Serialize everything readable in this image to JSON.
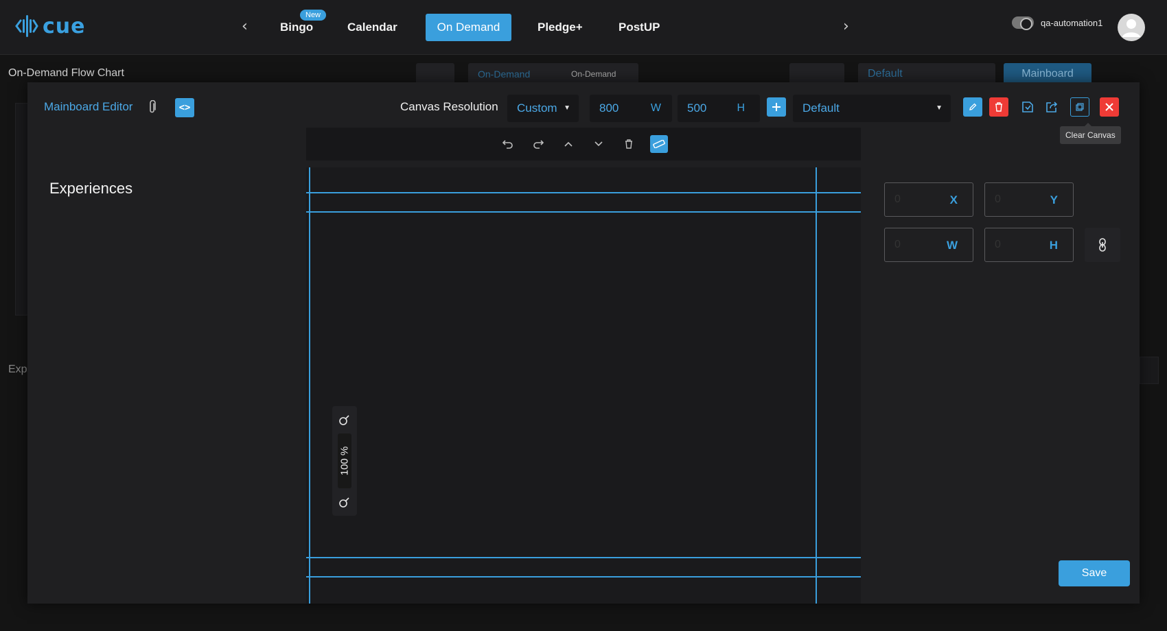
{
  "app": {
    "logo_text": "cue"
  },
  "nav": {
    "items": [
      {
        "label": "Bingo",
        "badge": "New"
      },
      {
        "label": "Calendar"
      },
      {
        "label": "On Demand"
      },
      {
        "label": "Pledge+"
      },
      {
        "label": "PostUP"
      }
    ],
    "active": "On Demand"
  },
  "user": {
    "name": "qa-automation1"
  },
  "background_page": {
    "title": "On-Demand Flow Chart",
    "experience_select": "On-Demand",
    "experience_type": "On-Demand",
    "default_select": "Default",
    "mainboard_button": "Mainboard",
    "experiences_partial": "Exp"
  },
  "modal": {
    "title": "Mainboard Editor",
    "canvas_resolution_label": "Canvas Resolution",
    "resolution_preset": "Custom",
    "width_value": "800",
    "width_suffix": "W",
    "height_value": "500",
    "height_suffix": "H",
    "layout_select": "Default",
    "tooltip": "Clear Canvas",
    "sidebar_title": "Experiences",
    "zoom_label": "100 %",
    "properties": {
      "x": {
        "value": "0",
        "suffix": "X"
      },
      "y": {
        "value": "0",
        "suffix": "Y"
      },
      "w": {
        "value": "0",
        "suffix": "W"
      },
      "h": {
        "value": "0",
        "suffix": "H"
      }
    },
    "save_label": "Save"
  },
  "icons": {
    "attach": "paperclip-icon",
    "code": "code-icon",
    "add": "plus-icon",
    "edit": "pencil-icon",
    "delete": "trash-icon",
    "save_file": "save-file-icon",
    "export": "share-icon",
    "clear": "clear-canvas-icon",
    "close": "close-icon",
    "undo": "undo-icon",
    "redo": "redo-icon",
    "up": "chevron-up-icon",
    "down": "chevron-down-icon",
    "ruler": "ruler-icon",
    "zoom_in": "zoom-in-icon",
    "zoom_out": "zoom-out-icon",
    "link": "link-icon"
  },
  "colors": {
    "accent": "#3a9fdd",
    "danger": "#ef3b36",
    "background": "#1f1f21"
  }
}
